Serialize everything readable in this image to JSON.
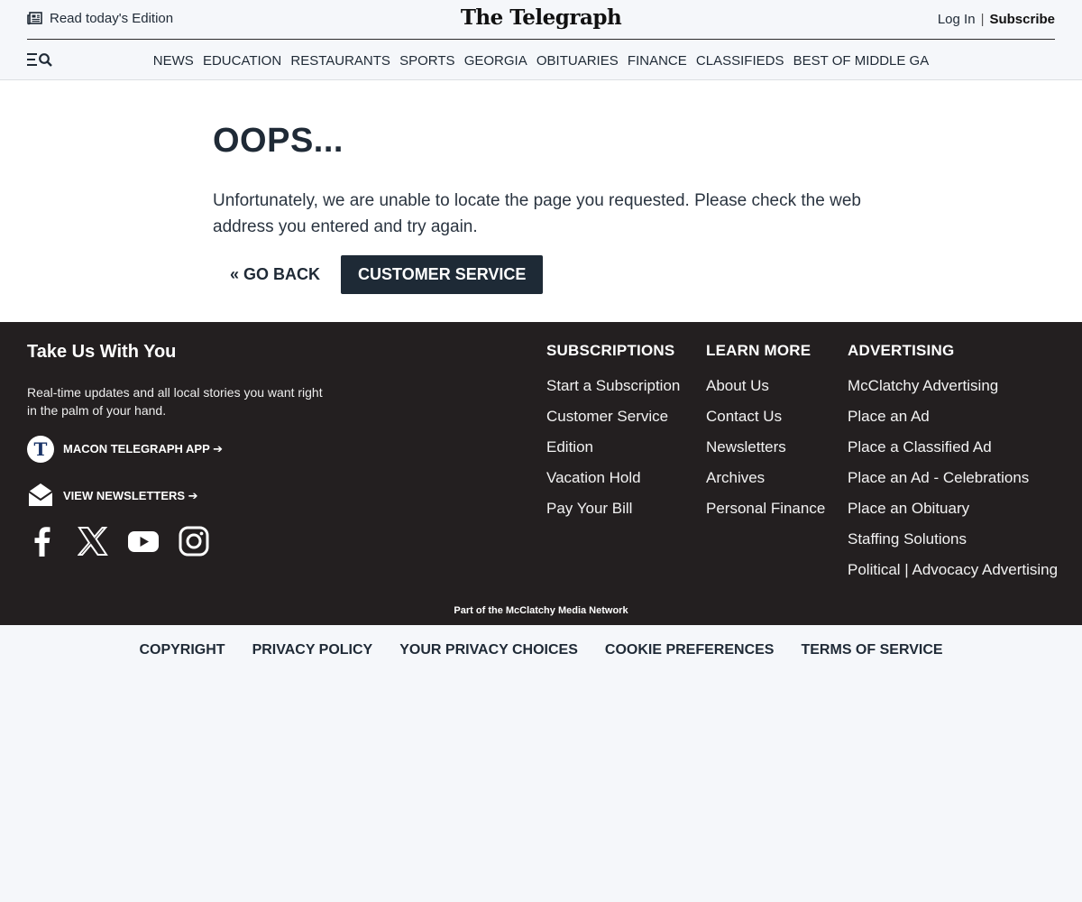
{
  "header": {
    "edition_label": "Read today's Edition",
    "logo": "The Telegraph",
    "login_label": "Log In",
    "separator": "|",
    "subscribe_label": "Subscribe"
  },
  "nav": {
    "items": [
      "NEWS",
      "EDUCATION",
      "RESTAURANTS",
      "SPORTS",
      "GEORGIA",
      "OBITUARIES",
      "FINANCE",
      "CLASSIFIEDS",
      "BEST OF MIDDLE GA"
    ]
  },
  "error": {
    "title": "OOPS...",
    "message": "Unfortunately, we are unable to locate the page you requested. Please check the web address you entered and try again.",
    "go_back_label": "« GO BACK",
    "customer_service_label": "CUSTOMER SERVICE"
  },
  "footer": {
    "take_us_title": "Take Us With You",
    "take_us_desc": "Real-time updates and all local stories you want right in the palm of your hand.",
    "app_badge": "T",
    "app_link": "MACON TELEGRAPH APP ➔",
    "newsletters_link": "VIEW NEWSLETTERS ➔",
    "subscriptions": {
      "heading": "SUBSCRIPTIONS",
      "items": [
        "Start a Subscription",
        "Customer Service",
        "Edition",
        "Vacation Hold",
        "Pay Your Bill"
      ]
    },
    "learn_more": {
      "heading": "LEARN MORE",
      "items": [
        "About Us",
        "Contact Us",
        "Newsletters",
        "Archives",
        "Personal Finance"
      ]
    },
    "advertising": {
      "heading": "ADVERTISING",
      "items": [
        "McClatchy Advertising",
        "Place an Ad",
        "Place a Classified Ad",
        "Place an Ad - Celebrations",
        "Place an Obituary",
        "Staffing Solutions",
        "Political | Advocacy Advertising"
      ]
    },
    "network": "Part of the McClatchy Media Network"
  },
  "legal": {
    "items": [
      "COPYRIGHT",
      "PRIVACY POLICY",
      "YOUR PRIVACY CHOICES",
      "COOKIE PREFERENCES",
      "TERMS OF SERVICE"
    ]
  },
  "colors": {
    "text_dark": "#1f2a36",
    "footer_bg": "#231f20",
    "button_bg": "#1e2a36",
    "page_bg": "#f5f7fa"
  }
}
